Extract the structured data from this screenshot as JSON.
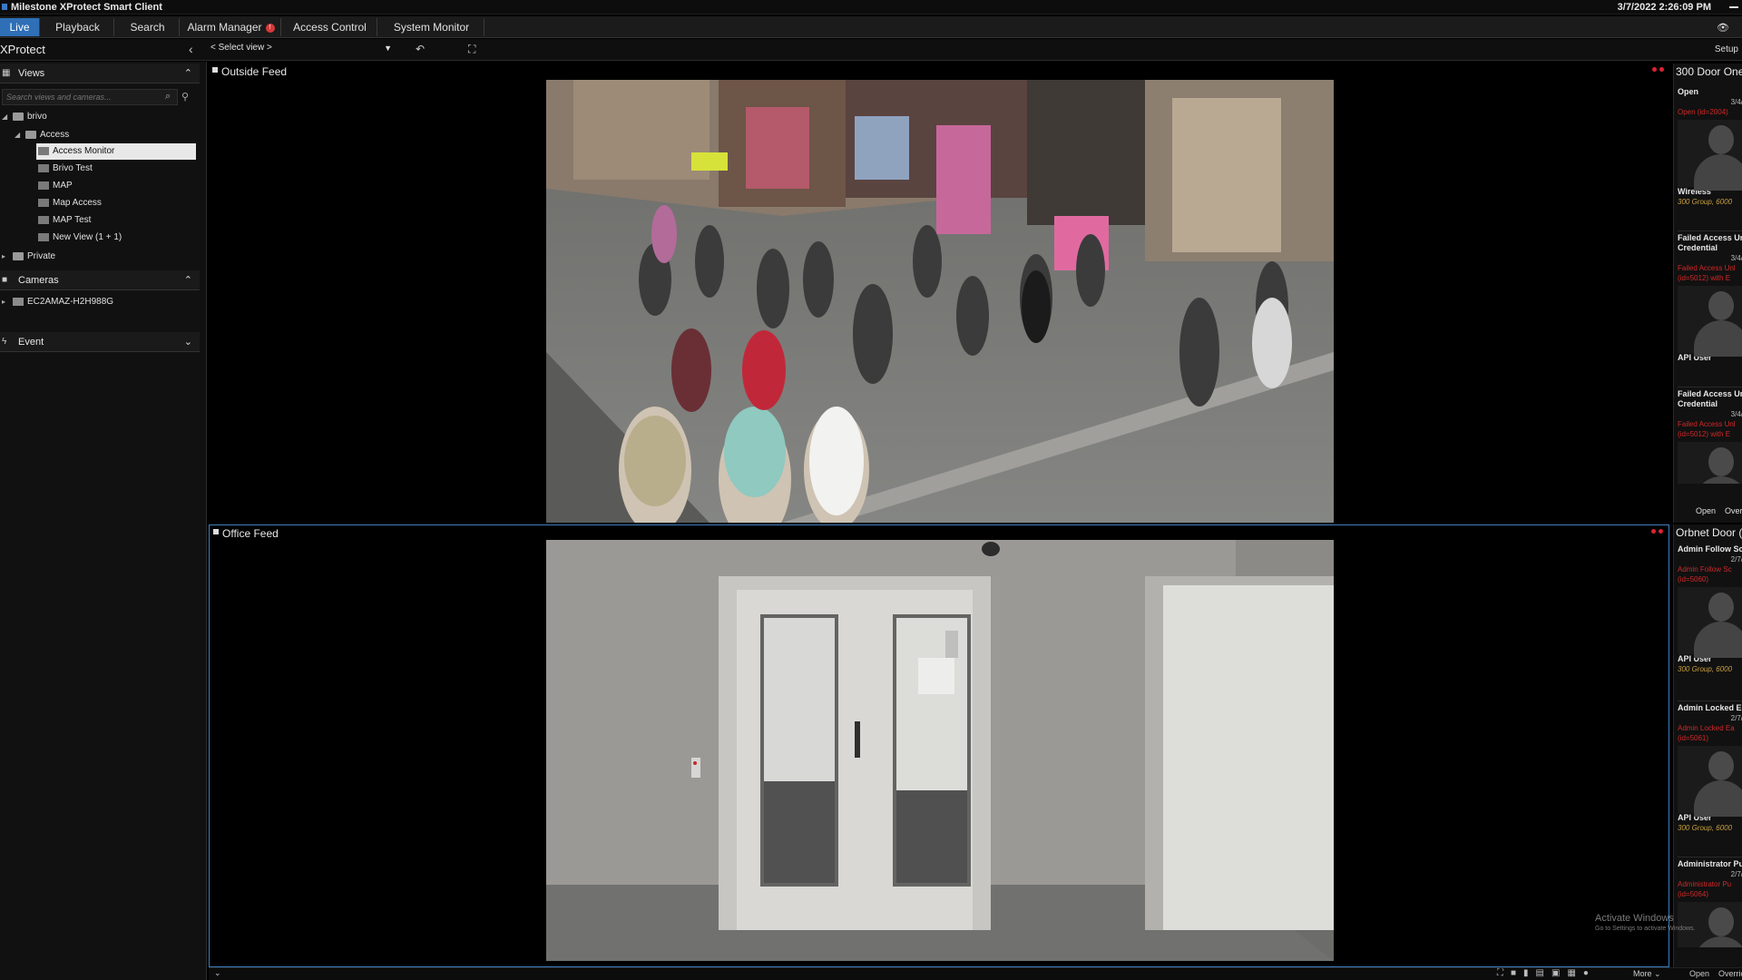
{
  "window": {
    "title": "Milestone XProtect Smart Client",
    "datetime": "3/7/2022 2:26:09 PM"
  },
  "tabs": [
    {
      "label": "Live",
      "active": true
    },
    {
      "label": "Playback"
    },
    {
      "label": "Search"
    },
    {
      "label": "Alarm Manager",
      "badge": "!"
    },
    {
      "label": "Access Control"
    },
    {
      "label": "System Monitor"
    }
  ],
  "toolbar": {
    "brand": "XProtect",
    "select_view": "< Select view >",
    "setup_label": "Setup"
  },
  "sidebar": {
    "views_header": "Views",
    "search_placeholder": "Search views and cameras...",
    "tree": [
      {
        "label": "brivo",
        "level": 0,
        "kind": "folder"
      },
      {
        "label": "Access",
        "level": 1,
        "kind": "folder"
      },
      {
        "label": "Access Monitor",
        "level": 2,
        "kind": "view",
        "selected": true
      },
      {
        "label": "Brivo Test",
        "level": 2,
        "kind": "view"
      },
      {
        "label": "MAP",
        "level": 2,
        "kind": "view"
      },
      {
        "label": "Map Access",
        "level": 2,
        "kind": "view"
      },
      {
        "label": "MAP Test",
        "level": 2,
        "kind": "view"
      },
      {
        "label": "New View (1 + 1)",
        "level": 2,
        "kind": "view"
      },
      {
        "label": "Private",
        "level": 0,
        "kind": "folder"
      }
    ],
    "cameras_header": "Cameras",
    "camera_server": "EC2AMAZ-H2H988G",
    "event_header": "Event"
  },
  "feeds": {
    "outside": {
      "title": "Outside Feed"
    },
    "office": {
      "title": "Office Feed"
    }
  },
  "access_panels": {
    "top": {
      "title": "300 Door One",
      "events": [
        {
          "header": "Open",
          "date": "3/4/",
          "detail": "Open (id=2004)",
          "user": "Wireless",
          "group": "300 Group, 6000"
        },
        {
          "header": "Failed Access Un",
          "header2": "Credential",
          "date": "3/4/",
          "detail": "Failed Access Unl",
          "detail2": "(id=5012) with E",
          "user": "API User"
        },
        {
          "header": "Failed Access Un",
          "header2": "Credential",
          "date": "3/4/",
          "detail": "Failed Access Unl",
          "detail2": "(id=5012) with E"
        }
      ],
      "footer": [
        "Open",
        "Overric"
      ]
    },
    "bottom": {
      "title": "Orbnet Door (",
      "events": [
        {
          "header": "Admin Follow Sc",
          "date": "2/7/",
          "detail": "Admin Follow Sc",
          "detail2": "(id=5060)",
          "user": "API User",
          "group": "300 Group, 6000"
        },
        {
          "header": "Admin Locked E",
          "date": "2/7/",
          "detail": "Admin Locked Ea",
          "detail2": "(id=5061)",
          "user": "API User",
          "group": "300 Group, 6000"
        },
        {
          "header": "Administrator Pu",
          "date": "2/7/",
          "detail": "Administrator Pu",
          "detail2": "(id=5064)"
        }
      ],
      "footer": [
        "Open",
        "Overric"
      ]
    }
  },
  "bottom_bar": {
    "more_label": "More"
  },
  "watermark": {
    "line1": "Activate Windows",
    "line2": "Go to Settings to activate Windows."
  }
}
